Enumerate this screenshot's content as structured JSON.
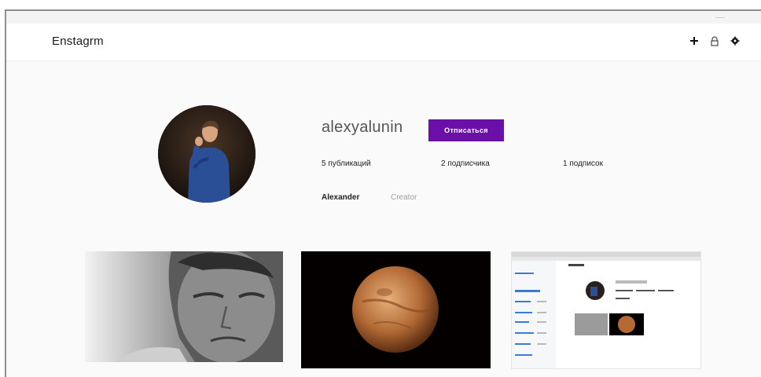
{
  "header": {
    "logo": "Enstagrm",
    "icons": [
      "plus-icon",
      "lock-icon",
      "settings-icon"
    ]
  },
  "profile": {
    "username": "alexyalunin",
    "follow_button": "Отписаться",
    "stats": {
      "posts": "5 публикаций",
      "followers": "2 подписчика",
      "following": "1 подписок"
    },
    "full_name": "Alexander",
    "bio": "Creator"
  },
  "posts": [
    {
      "alt": "portrait-photo"
    },
    {
      "alt": "planet-photo"
    },
    {
      "alt": "screenshot-photo"
    }
  ],
  "colors": {
    "accent": "#6a0fa8",
    "background": "#fafafa",
    "header": "#ffffff"
  }
}
